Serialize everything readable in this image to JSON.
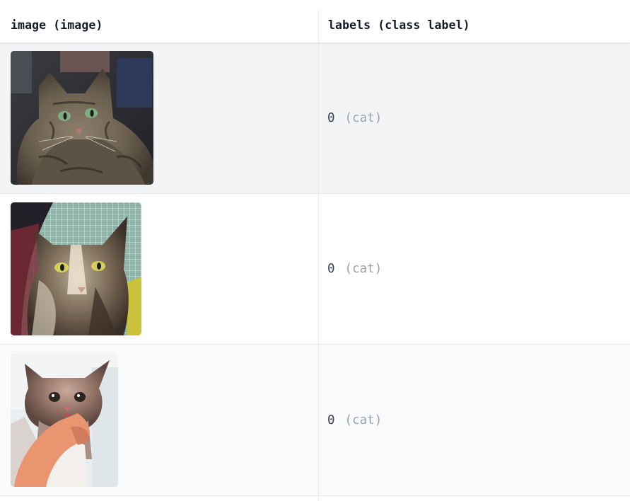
{
  "columns": [
    {
      "label": "image (image)"
    },
    {
      "label": "labels (class label)"
    }
  ],
  "rows": [
    {
      "image": "tabby-cat-photo",
      "label_value": "0",
      "label_name": "(cat)"
    },
    {
      "image": "tortoiseshell-cat-photo",
      "label_value": "0",
      "label_name": "(cat)"
    },
    {
      "image": "kitten-in-hand-photo",
      "label_value": "0",
      "label_name": "(cat)"
    }
  ],
  "colors": {
    "row_alt_bg": "#f3f4f6",
    "row_bg": "#ffffff",
    "row_bg_3": "#f9fafb",
    "header_text": "#111827",
    "label_value": "#374151",
    "label_name": "#9ca3af"
  }
}
